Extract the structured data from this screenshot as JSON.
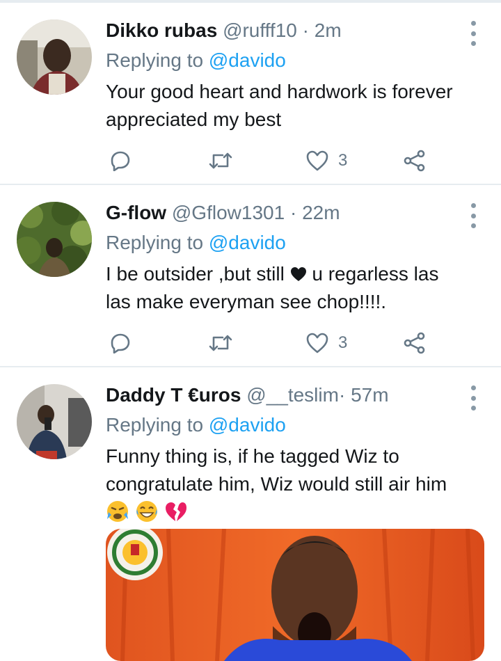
{
  "tweets": [
    {
      "name": "Dikko rubas",
      "handle": "@rufff10",
      "separator": "·",
      "time": "2m",
      "replying_prefix": "Replying to ",
      "replying_handle": "@davido",
      "text_line1": "Your good heart and hardwork is forever",
      "text_line2": "appreciated my best",
      "likes": "3"
    },
    {
      "name": "G-flow",
      "handle": "@Gflow1301",
      "separator": "·",
      "time": "22m",
      "replying_prefix": "Replying to ",
      "replying_handle": "@davido",
      "text_line1a": "I be outsider ,but still ",
      "text_line1b": " u regarless  las",
      "text_line2": "las make everyman see chop!!!!.",
      "likes": "3"
    },
    {
      "name": "Daddy T €uros",
      "handle": "@__teslim",
      "separator": "·",
      "time": "57m",
      "replying_prefix": "Replying to ",
      "replying_handle": "@davido",
      "text_line1": "Funny thing is, if he tagged Wiz to",
      "text_line2": "congratulate him, Wiz would still air him"
    }
  ],
  "icons": {
    "reply": "reply-icon",
    "retweet": "retweet-icon",
    "like": "heart-icon",
    "share": "share-icon",
    "more": "more-vertical-icon"
  },
  "colors": {
    "accent": "#1da1f2",
    "secondary_text": "#657786",
    "divider": "#e6ecf0"
  }
}
